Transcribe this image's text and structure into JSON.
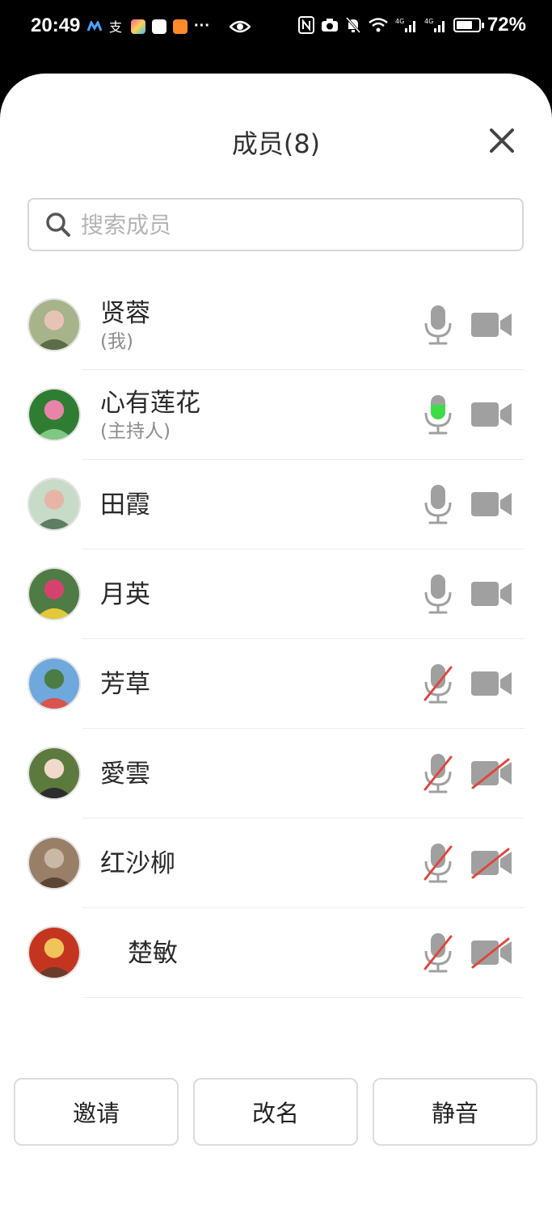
{
  "status_bar": {
    "time": "20:49",
    "battery": "72%",
    "battery_level": 0.72,
    "icons": [
      "app-m-icon",
      "alipay-icon",
      "app-store-icon",
      "huawei-icon",
      "video-app-icon",
      "more-dots-icon",
      "eye-icon",
      "nfc-icon",
      "camera-icon",
      "bell-off-icon",
      "wifi-icon",
      "signal-4g-icon",
      "signal-4g-icon",
      "battery-icon"
    ],
    "more": "···"
  },
  "sheet": {
    "title": "成员(8)",
    "close_icon": "close-icon",
    "search": {
      "placeholder": "搜索成员",
      "value": ""
    }
  },
  "members": [
    {
      "name": "贤蓉",
      "role": "(我)",
      "mic": "on",
      "camera": "on",
      "avatar_colors": [
        "#a7b48b",
        "#e7c3b5",
        "#5b6d46"
      ]
    },
    {
      "name": "心有莲花",
      "role": "(主持人)",
      "mic": "speaking",
      "camera": "on",
      "avatar_colors": [
        "#2e7d32",
        "#e884a8",
        "#81c784"
      ]
    },
    {
      "name": "田霞",
      "role": "",
      "mic": "on",
      "camera": "on",
      "avatar_colors": [
        "#c8dbc8",
        "#e8b4a8",
        "#5f7d63"
      ]
    },
    {
      "name": "月英",
      "role": "",
      "mic": "on",
      "camera": "on",
      "avatar_colors": [
        "#4f7b44",
        "#d6426e",
        "#e3c93a"
      ]
    },
    {
      "name": "芳草",
      "role": "",
      "mic": "muted",
      "camera": "on",
      "avatar_colors": [
        "#6fa8dc",
        "#4c7c45",
        "#d9534f"
      ]
    },
    {
      "name": "愛雲",
      "role": "",
      "mic": "muted",
      "camera": "off",
      "avatar_colors": [
        "#5c7a3e",
        "#f1d9cc",
        "#2d2d2d"
      ]
    },
    {
      "name": "红沙柳",
      "role": "",
      "mic": "muted",
      "camera": "off",
      "avatar_colors": [
        "#9a7f68",
        "#c9b8a6",
        "#5b4636"
      ]
    },
    {
      "name": "楚敏",
      "role": "",
      "mic": "muted",
      "camera": "off",
      "avatar_colors": [
        "#c4351f",
        "#f0c45a",
        "#6a3b2b"
      ]
    }
  ],
  "colors": {
    "icon_gray": "#a0a0a0",
    "speaking_green": "#3ddc48",
    "muted_red": "#e0463b"
  },
  "buttons": {
    "invite": "邀请",
    "rename": "改名",
    "mute": "静音"
  }
}
